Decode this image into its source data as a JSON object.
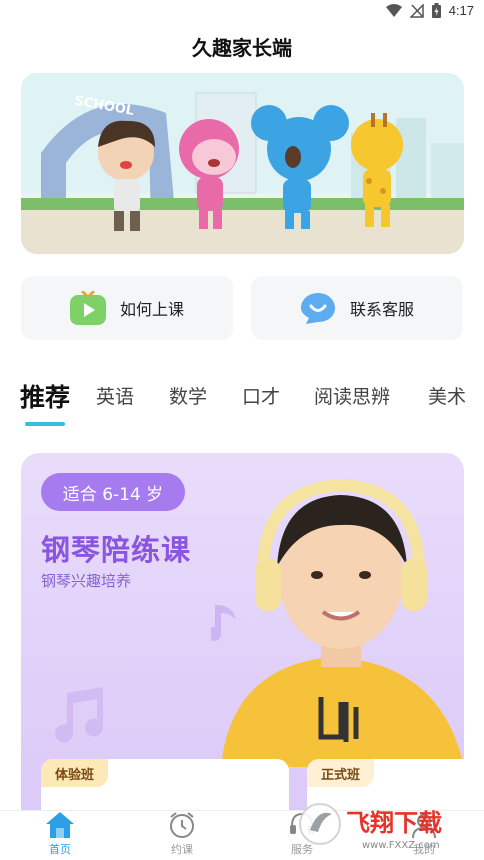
{
  "status_bar": {
    "time": "4:17"
  },
  "app": {
    "title": "久趣家长端"
  },
  "banner": {
    "sign_text": "SCHOOL"
  },
  "quick_actions": [
    {
      "label": "如何上课",
      "icon": "play-video-icon"
    },
    {
      "label": "联系客服",
      "icon": "chat-bubble-icon"
    }
  ],
  "tabs": [
    {
      "label": "推荐",
      "active": true
    },
    {
      "label": "英语"
    },
    {
      "label": "数学"
    },
    {
      "label": "口才"
    },
    {
      "label": "阅读思辨"
    },
    {
      "label": "美术"
    }
  ],
  "course": {
    "age_range": "适合 6-14 岁",
    "title": "钢琴陪练课",
    "subtitle": "钢琴兴趣培养",
    "trial_label": "体验班",
    "formal_label": "正式班"
  },
  "bottom_nav": [
    {
      "label": "首页",
      "icon": "home-icon",
      "active": true
    },
    {
      "label": "约课",
      "icon": "alarm-clock-icon"
    },
    {
      "label": "服务",
      "icon": "service-icon"
    },
    {
      "label": "我的",
      "icon": "profile-icon"
    }
  ],
  "watermark": {
    "text": "飞翔下载",
    "url_text": "www.FXXZ.com"
  },
  "colors": {
    "accent": "#33c0dc",
    "course_purple": "#8a55e0",
    "nav_active": "#2d9fe6"
  }
}
